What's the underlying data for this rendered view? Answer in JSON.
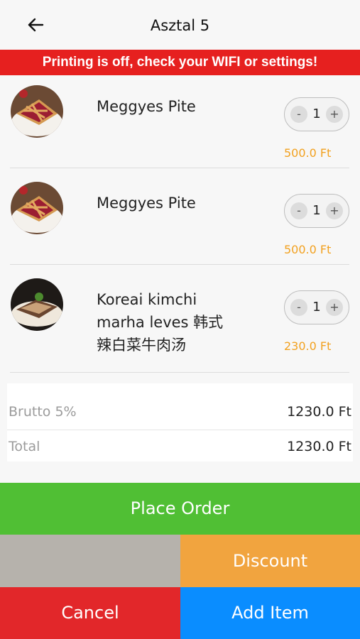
{
  "header": {
    "title": "Asztal 5",
    "back_icon": "arrow-left-icon"
  },
  "banner": {
    "text": "Printing is off, check your WIFI or settings!",
    "color": "#e6201f"
  },
  "items": [
    {
      "name": "Meggyes Pite",
      "qty": "1",
      "price": "500.0 Ft",
      "image": "cherry-pie-image"
    },
    {
      "name": "Meggyes Pite",
      "qty": "1",
      "price": "500.0 Ft",
      "image": "cherry-pie-image"
    },
    {
      "name": "Koreai kimchi marha leves 韩式辣白菜牛肉汤",
      "qty": "1",
      "price": "230.0 Ft",
      "image": "dish-image"
    }
  ],
  "stepper": {
    "minus": "-",
    "plus": "+"
  },
  "summary": {
    "brutto_label": "Brutto 5%",
    "brutto_value": "1230.0 Ft",
    "total_label": "Total",
    "total_value": "1230.0 Ft"
  },
  "actions": {
    "place_order": "Place Order",
    "discount": "Discount",
    "cancel": "Cancel",
    "add_item": "Add Item"
  },
  "colors": {
    "place_order": "#50bf34",
    "discount": "#f1a43f",
    "cancel": "#e2272a",
    "add_item": "#0a8dff",
    "price": "#f2a11f"
  }
}
